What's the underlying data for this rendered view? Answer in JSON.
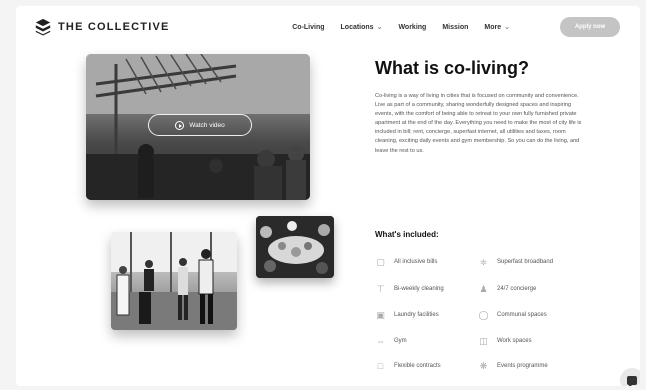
{
  "brand": {
    "name": "THE COLLECTIVE"
  },
  "nav": {
    "items": [
      {
        "label": "Co-Living",
        "dropdown": false
      },
      {
        "label": "Locations",
        "dropdown": true
      },
      {
        "label": "Working",
        "dropdown": false
      },
      {
        "label": "Mission",
        "dropdown": false
      },
      {
        "label": "More",
        "dropdown": true
      }
    ],
    "apply_label": "Apply now"
  },
  "hero": {
    "watch_label": "Watch video"
  },
  "content": {
    "title": "What is co-living?",
    "description": "Co-living is a way of living in cities that is focused on community and convenience. Live as part of a community, sharing wonderfully designed spaces and inspiring events, with the comfort of being able to retreat to your own fully furnished private apartment at the end of the day. Everything you need to make the most of city life is included in bill; rent, concierge, superfast internet, all utilities and taxes, room cleaning, exciting daily events and gym membership. So you can do the living, and leave the rest to us.",
    "included_title": "What's included:",
    "features": [
      {
        "label": "All inclusive bills",
        "icon": "bill-icon"
      },
      {
        "label": "Superfast broadband",
        "icon": "wifi-icon"
      },
      {
        "label": "Bi-weekly cleaning",
        "icon": "cleaning-icon"
      },
      {
        "label": "24/7 concierge",
        "icon": "concierge-icon"
      },
      {
        "label": "Laundry facilities",
        "icon": "laundry-icon"
      },
      {
        "label": "Communal spaces",
        "icon": "sofa-icon"
      },
      {
        "label": "Gym",
        "icon": "dumbbell-icon"
      },
      {
        "label": "Work spaces",
        "icon": "desk-icon"
      },
      {
        "label": "Flexible contracts",
        "icon": "contract-icon"
      },
      {
        "label": "Events programme",
        "icon": "events-icon"
      }
    ]
  }
}
